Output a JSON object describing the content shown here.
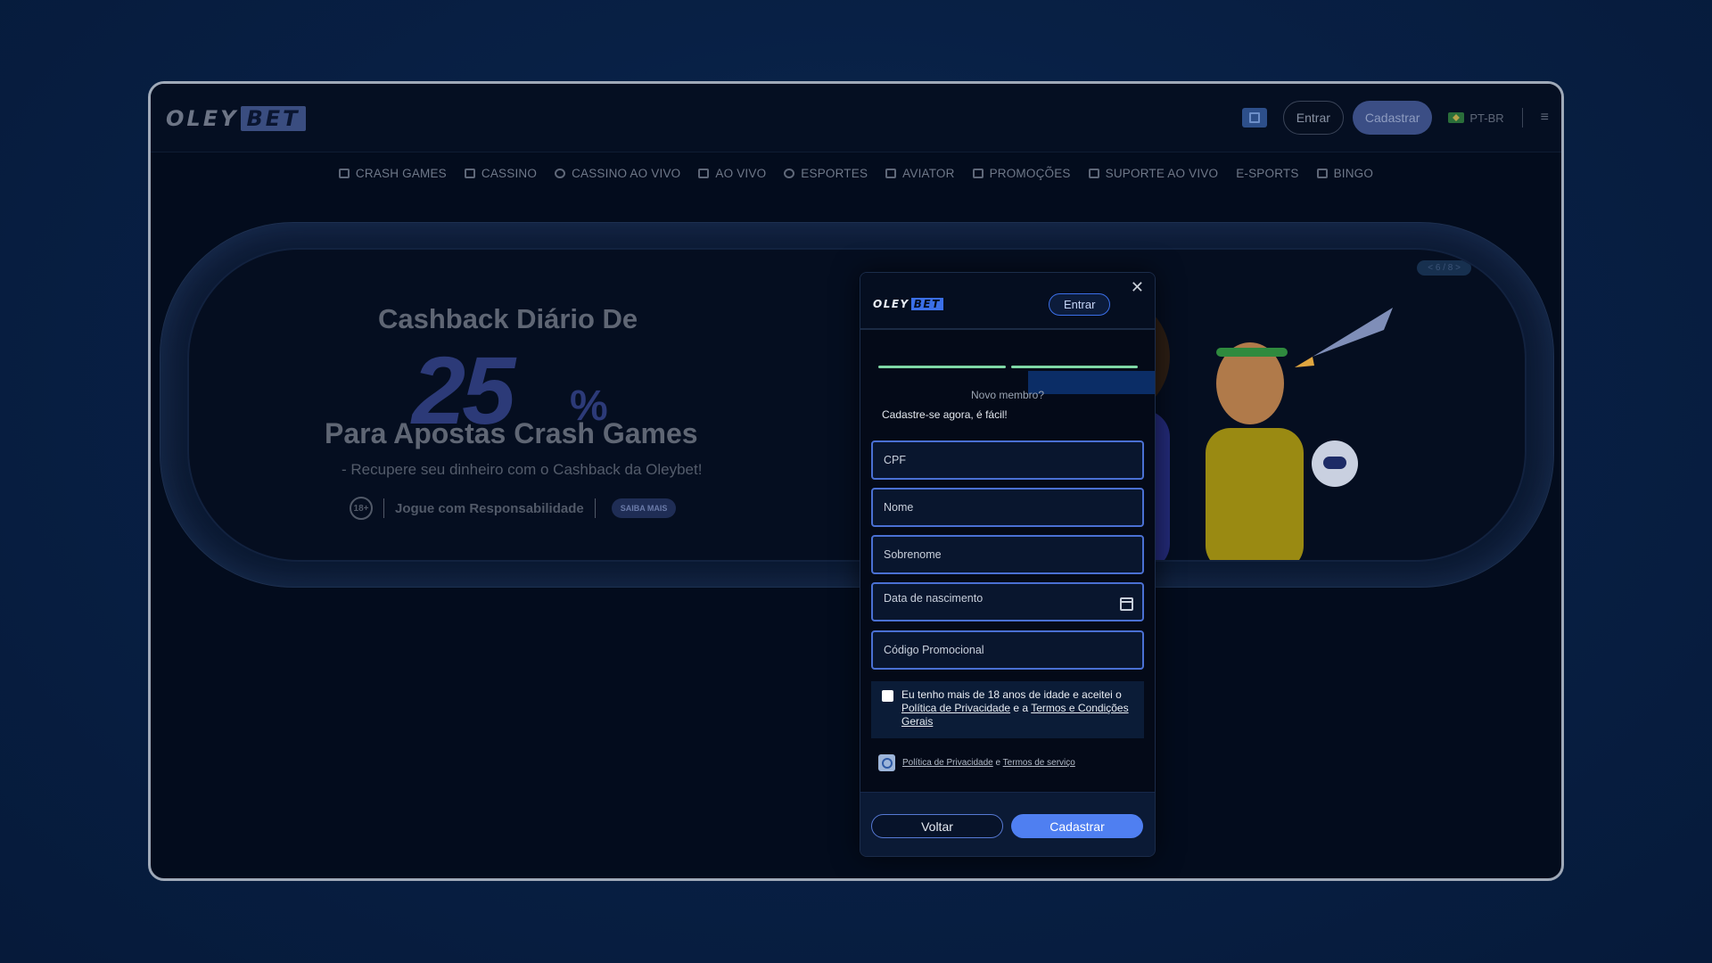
{
  "header": {
    "logo_part1": "OLEY",
    "logo_part2": "BET",
    "login_label": "Entrar",
    "register_label": "Cadastrar",
    "language": "PT-BR"
  },
  "nav": {
    "items": [
      {
        "label": "CRASH GAMES",
        "icon": "chart-icon"
      },
      {
        "label": "CASSINO",
        "icon": "slots-icon"
      },
      {
        "label": "CASSINO AO VIVO",
        "icon": "chip-icon"
      },
      {
        "label": "AO VIVO",
        "icon": "live-icon"
      },
      {
        "label": "ESPORTES",
        "icon": "ball-icon"
      },
      {
        "label": "AVIATOR",
        "icon": "plane-icon"
      },
      {
        "label": "PROMOÇÕES",
        "icon": "gift-icon"
      },
      {
        "label": "SUPORTE AO VIVO",
        "icon": "chat-icon"
      },
      {
        "label": "E-SPORTS",
        "icon": ""
      },
      {
        "label": "BINGO",
        "icon": "bingo-icon"
      }
    ]
  },
  "banner": {
    "title": "Cashback Diário De",
    "number": "25",
    "percent": "%",
    "subtitle": "Para Apostas Crash Games",
    "recover": "- Recupere seu dinheiro com o Cashback da Oleybet!",
    "age": "18+",
    "responsible": "Jogue com Responsabilidade",
    "more": "SAIBA MAIS",
    "pager": "< 6 / 8 >"
  },
  "modal": {
    "logo_part1": "OLEY",
    "logo_part2": "BET",
    "login_label": "Entrar",
    "new_member": "Novo membro?",
    "register_easy": "Cadastre-se agora, é fácil!",
    "fields": {
      "cpf": "CPF",
      "name": "Nome",
      "surname": "Sobrenome",
      "birthdate": "Data de nascimento",
      "promo": "Código Promocional"
    },
    "agree_text_1": "Eu tenho mais de 18 anos de idade e aceitei o ",
    "agree_privacy": "Política de Privacidade",
    "agree_text_2": " e a ",
    "agree_terms": "Termos e Condições Gerais",
    "recaptcha_privacy": "Política de Privacidade",
    "recaptcha_and": " e ",
    "recaptcha_terms": "Termos de serviço",
    "back_label": "Voltar",
    "register_label": "Cadastrar"
  },
  "colors": {
    "accent": "#4f7ff1",
    "progress": "#7fd8a6",
    "field_border": "#4a70d3"
  }
}
